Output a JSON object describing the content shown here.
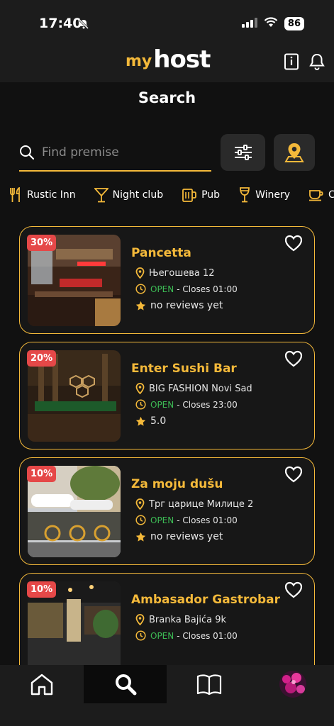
{
  "status": {
    "time": "17:40",
    "battery": "86"
  },
  "header": {
    "logo_my": "my",
    "logo_host": "host"
  },
  "page": {
    "title": "Search"
  },
  "search": {
    "placeholder": "Find premise"
  },
  "categories": [
    {
      "label": "Rustic Inn",
      "icon": "fork-knife-icon"
    },
    {
      "label": "Night club",
      "icon": "cocktail-icon"
    },
    {
      "label": "Pub",
      "icon": "beer-icon"
    },
    {
      "label": "Winery",
      "icon": "wine-glass-icon"
    },
    {
      "label": "Co",
      "icon": "coffee-cup-icon"
    }
  ],
  "places": [
    {
      "name": "Pancetta",
      "discount": "30%",
      "address": "Његошева 12",
      "open": "OPEN",
      "closes": "- Closes 01:00",
      "rating": "no reviews yet"
    },
    {
      "name": "Enter Sushi Bar",
      "discount": "20%",
      "address": "BIG FASHION Novi Sad",
      "open": "OPEN",
      "closes": "- Closes 23:00",
      "rating": "5.0"
    },
    {
      "name": "Za moju dušu",
      "discount": "10%",
      "address": "Трг царице Милице 2",
      "open": "OPEN",
      "closes": "- Closes 01:00",
      "rating": "no reviews yet"
    },
    {
      "name": "Ambasador Gastrobar",
      "discount": "10%",
      "address": "Branka Bajića 9k",
      "open": "OPEN",
      "closes": "- Closes 01:00",
      "rating": ""
    }
  ],
  "colors": {
    "accent": "#f4b93a",
    "open": "#3cba54",
    "badge": "#e54848",
    "background": "#111111"
  },
  "nav": [
    {
      "icon": "home-icon"
    },
    {
      "icon": "search-icon",
      "active": true
    },
    {
      "icon": "book-icon"
    },
    {
      "icon": "avatar"
    }
  ]
}
